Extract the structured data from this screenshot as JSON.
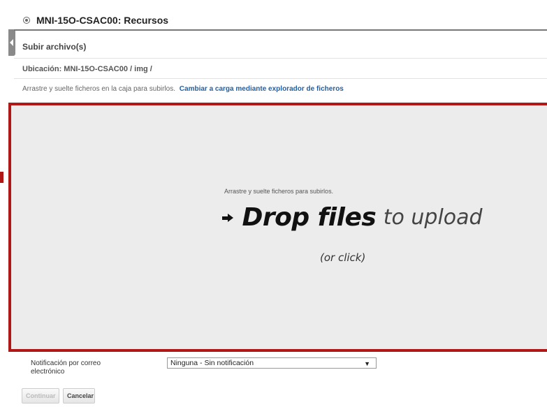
{
  "header": {
    "title": "MNI-15O-CSAC00: Recursos"
  },
  "upload": {
    "subtitle": "Subir archivo(s)",
    "location": "Ubicación: MNI-15O-CSAC00 / img /",
    "instructions": "Arrastre y suelte ficheros en la caja para subirlos.",
    "switch_link": "Cambiar a carga mediante explorador de ficheros"
  },
  "dropzone": {
    "small_text": "Arrastre y suelte ficheros para subirlos.",
    "bold_text": "Drop files",
    "light_text": "to upload",
    "click_text": "(or click)"
  },
  "notification": {
    "label": "Notificación por correo electrónico",
    "selected": "Ninguna - Sin notificación"
  },
  "buttons": {
    "continue": "Continuar",
    "cancel": "Cancelar"
  },
  "colors": {
    "highlight_border": "#b01818",
    "link": "#1f5fa6"
  }
}
